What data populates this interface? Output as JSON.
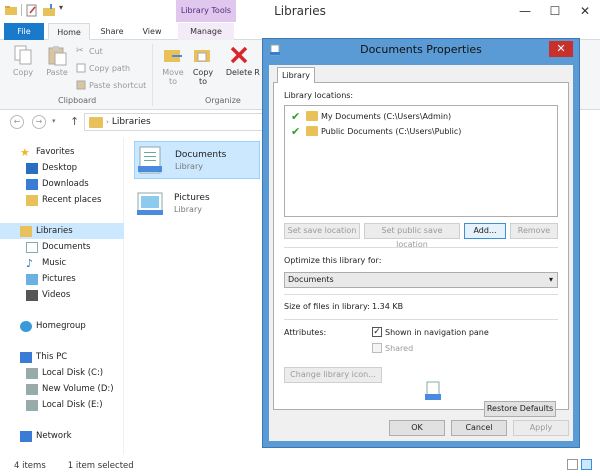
{
  "window": {
    "title": "Libraries",
    "context_tab_group": "Library Tools",
    "minimize": "—",
    "maximize": "☐",
    "close": "✕"
  },
  "ribbon": {
    "tabs": [
      "File",
      "Home",
      "Share",
      "View",
      "Manage"
    ],
    "clipboard": {
      "copy": "Copy",
      "paste": "Paste",
      "cut": "Cut",
      "copy_path": "Copy path",
      "paste_shortcut": "Paste shortcut",
      "group_label": "Clipboard"
    },
    "organize": {
      "move_to": "Move",
      "move_to_2": "to",
      "copy_to": "Copy",
      "copy_to_2": "to",
      "delete": "Delete",
      "rename_partial": "R",
      "group_label": "Organize"
    }
  },
  "address": {
    "path": "Libraries"
  },
  "nav": {
    "favorites": "Favorites",
    "desktop": "Desktop",
    "downloads": "Downloads",
    "recent": "Recent places",
    "libraries": "Libraries",
    "documents": "Documents",
    "music": "Music",
    "pictures": "Pictures",
    "videos": "Videos",
    "homegroup": "Homegroup",
    "this_pc": "This PC",
    "local_c": "Local Disk (C:)",
    "new_volume_d": "New Volume (D:)",
    "local_e": "Local Disk (E:)",
    "network": "Network"
  },
  "content": {
    "items": [
      {
        "name": "Documents",
        "type": "Library"
      },
      {
        "name": "Pictures",
        "type": "Library"
      }
    ]
  },
  "status": {
    "count": "4 items",
    "selected": "1 item selected"
  },
  "dialog": {
    "title": "Documents Properties",
    "close": "✕",
    "tab": "Library",
    "locations_label": "Library locations:",
    "locations": [
      {
        "name": "My Documents (C:\\Users\\Admin)"
      },
      {
        "name": "Public Documents (C:\\Users\\Public)"
      }
    ],
    "buttons": {
      "set_save": "Set save location",
      "set_public_save": "Set public save location",
      "add": "Add...",
      "remove": "Remove",
      "change_icon": "Change library icon...",
      "restore": "Restore Defaults",
      "ok": "OK",
      "cancel": "Cancel",
      "apply": "Apply"
    },
    "optimize_label": "Optimize this library for:",
    "optimize_value": "Documents",
    "size_label": "Size of files in library:",
    "size_value": "1.34 KB",
    "attributes_label": "Attributes:",
    "attr_nav": "Shown in navigation pane",
    "attr_nav_checked": true,
    "attr_shared": "Shared",
    "attr_shared_checked": false
  }
}
